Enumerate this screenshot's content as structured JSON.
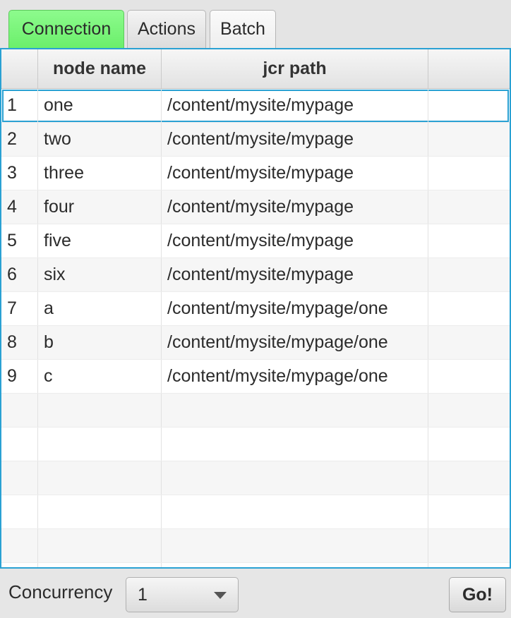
{
  "tabs": [
    {
      "label": "Connection",
      "active": true
    },
    {
      "label": "Actions",
      "active": false
    },
    {
      "label": "Batch",
      "active": false
    }
  ],
  "table": {
    "columns": [
      "",
      "node name",
      "jcr path",
      ""
    ],
    "rows": [
      {
        "index": "1",
        "name": "one",
        "path": "/content/mysite/mypage",
        "extra": ""
      },
      {
        "index": "2",
        "name": "two",
        "path": "/content/mysite/mypage",
        "extra": ""
      },
      {
        "index": "3",
        "name": "three",
        "path": "/content/mysite/mypage",
        "extra": ""
      },
      {
        "index": "4",
        "name": "four",
        "path": "/content/mysite/mypage",
        "extra": ""
      },
      {
        "index": "5",
        "name": "five",
        "path": "/content/mysite/mypage",
        "extra": ""
      },
      {
        "index": "6",
        "name": "six",
        "path": "/content/mysite/mypage",
        "extra": ""
      },
      {
        "index": "7",
        "name": "a",
        "path": "/content/mysite/mypage/one",
        "extra": ""
      },
      {
        "index": "8",
        "name": "b",
        "path": "/content/mysite/mypage/one",
        "extra": ""
      },
      {
        "index": "9",
        "name": "c",
        "path": "/content/mysite/mypage/one",
        "extra": ""
      },
      {
        "index": "",
        "name": "",
        "path": "",
        "extra": ""
      },
      {
        "index": "",
        "name": "",
        "path": "",
        "extra": ""
      },
      {
        "index": "",
        "name": "",
        "path": "",
        "extra": ""
      },
      {
        "index": "",
        "name": "",
        "path": "",
        "extra": ""
      },
      {
        "index": "",
        "name": "",
        "path": "",
        "extra": ""
      },
      {
        "index": "",
        "name": "",
        "path": "",
        "extra": ""
      }
    ],
    "selected_row": 0
  },
  "footer": {
    "concurrency_label": "Concurrency",
    "concurrency_value": "1",
    "go_label": "Go!"
  },
  "colors": {
    "active_tab": "#7ef57e",
    "focus_border": "#2aa1d3"
  }
}
